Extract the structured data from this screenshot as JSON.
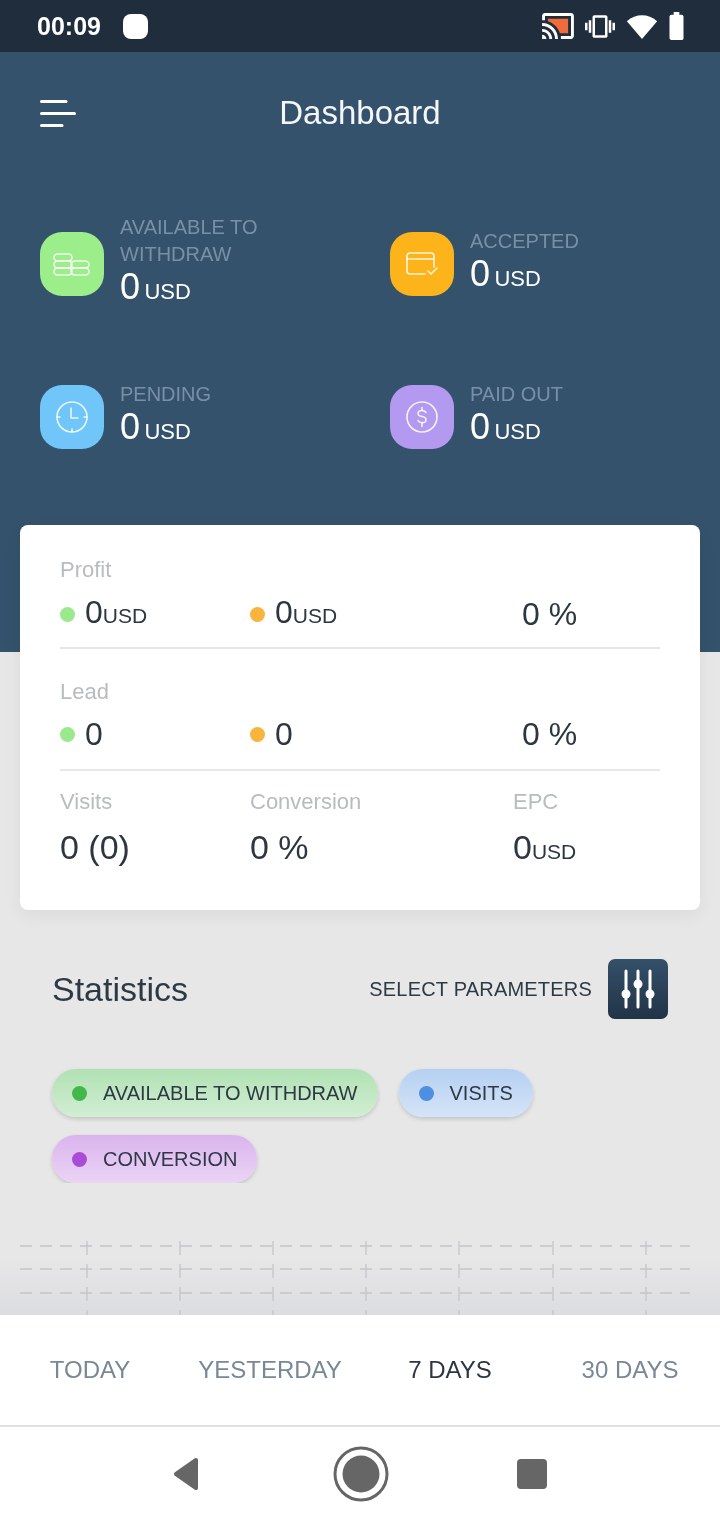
{
  "status_bar": {
    "time": "00:09"
  },
  "header": {
    "title": "Dashboard"
  },
  "balances": [
    {
      "kind": "coins",
      "color": "#9bee8a",
      "label": "AVAILABLE TO WITHDRAW",
      "value": "0",
      "unit": "USD"
    },
    {
      "kind": "card",
      "color": "#fdb41a",
      "label": "ACCEPTED",
      "value": "0",
      "unit": "USD"
    },
    {
      "kind": "clock",
      "color": "#70c6f8",
      "label": "PENDING",
      "value": "0",
      "unit": "USD"
    },
    {
      "kind": "dollar",
      "color": "#b39af0",
      "label": "PAID OUT",
      "value": "0",
      "unit": "USD"
    }
  ],
  "summary": {
    "sections": [
      {
        "label": "Profit",
        "items": [
          {
            "color": "#9be98d",
            "value": "0",
            "unit": "USD"
          },
          {
            "color": "#f8b43c",
            "value": "0",
            "unit": "USD"
          },
          {
            "value": "0 %"
          }
        ]
      },
      {
        "label": "Lead",
        "items": [
          {
            "color": "#9be98d",
            "value": "0"
          },
          {
            "color": "#f8b43c",
            "value": "0"
          },
          {
            "value": "0 %"
          }
        ]
      }
    ],
    "metrics": [
      {
        "label": "Visits",
        "value": "0 (0)"
      },
      {
        "label": "Conversion",
        "value": "0 %"
      },
      {
        "label": "EPC",
        "value": "0",
        "unit": "USD"
      }
    ]
  },
  "statistics": {
    "title": "Statistics",
    "select_label": "SELECT PARAMETERS",
    "parameters": [
      {
        "label": "AVAILABLE TO WITHDRAW",
        "color": "#43b84a"
      },
      {
        "label": "VISITS",
        "color": "#4f8fe0"
      },
      {
        "label": "CONVERSION",
        "color": "#a94cd6"
      }
    ]
  },
  "periods": [
    {
      "label": "TODAY",
      "selected": false
    },
    {
      "label": "YESTERDAY",
      "selected": false
    },
    {
      "label": "7 DAYS",
      "selected": true
    },
    {
      "label": "30 DAYS",
      "selected": false
    }
  ]
}
